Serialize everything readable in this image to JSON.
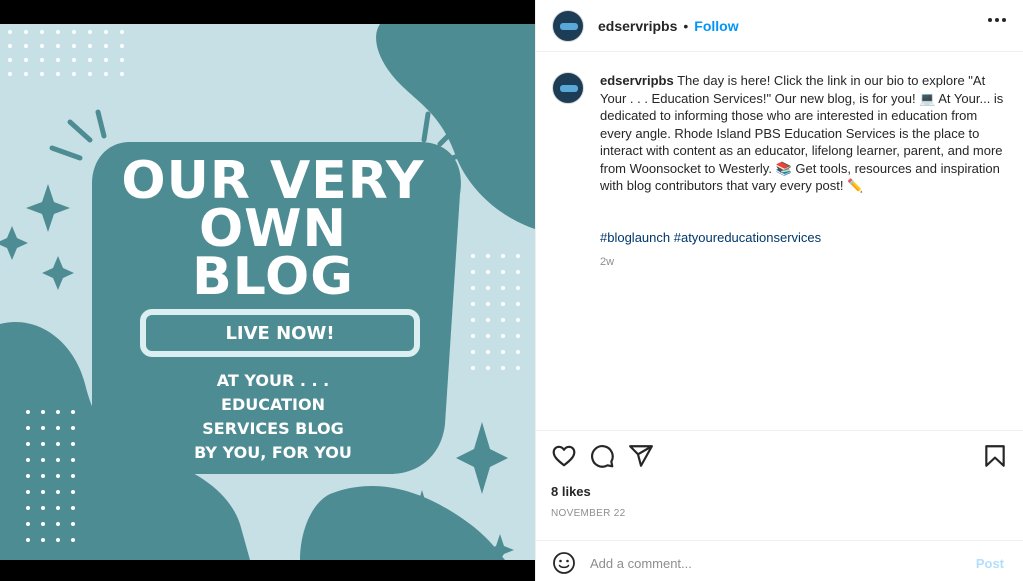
{
  "post_image": {
    "headline": "OUR VERY\nOWN\nBLOG",
    "badge": "LIVE NOW!",
    "subtext": "AT YOUR . . .\nEDUCATION\nSERVICES BLOG\nBY YOU, FOR YOU",
    "colors": {
      "background": "#c7e0e6",
      "shape": "#4e8c93",
      "text": "#ffffff"
    }
  },
  "header": {
    "username": "edservripbs",
    "separator": "•",
    "follow_label": "Follow",
    "more_icon": "more-horizontal-icon"
  },
  "caption": {
    "username": "edservripbs",
    "text": "The day is here! Click the link in our bio to explore \"At Your . . . Education Services!\" Our new blog, is for you! 💻 At Your... is dedicated to informing those who are interested in education from every angle. Rhode Island PBS Education Services is the place to interact with content as an educator, lifelong learner, parent, and more from Woonsocket to Westerly. 📚 Get tools, resources and inspiration with blog contributors that vary every post! ✏️",
    "hashtags": "#bloglaunch #atyoureducationservices",
    "time_ago": "2w"
  },
  "actions": {
    "like_icon": "heart-icon",
    "comment_icon": "comment-icon",
    "share_icon": "share-icon",
    "save_icon": "bookmark-icon"
  },
  "stats": {
    "likes": "8 likes",
    "date": "NOVEMBER 22"
  },
  "comment": {
    "emoji_icon": "emoji-icon",
    "placeholder": "Add a comment...",
    "post_label": "Post"
  },
  "colors": {
    "accent": "#0095f6",
    "hashtag": "#00376b",
    "muted": "#8e8e8e",
    "post_disabled": "#b2dffc"
  }
}
